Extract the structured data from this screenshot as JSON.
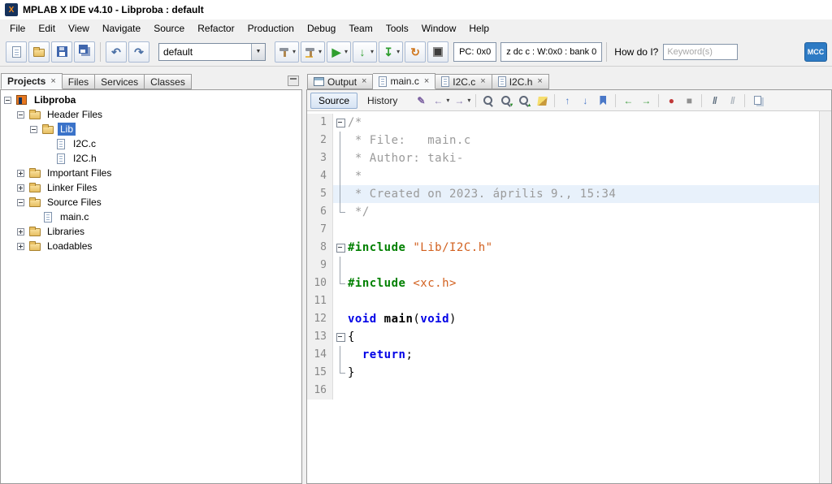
{
  "window": {
    "title": "MPLAB X IDE v4.10 - Libproba : default"
  },
  "menubar": {
    "items": [
      "File",
      "Edit",
      "View",
      "Navigate",
      "Source",
      "Refactor",
      "Production",
      "Debug",
      "Team",
      "Tools",
      "Window",
      "Help"
    ]
  },
  "toolbar": {
    "file_icons": [
      "new-file-icon",
      "open-project-icon",
      "save-icon",
      "save-all-icon"
    ],
    "history_icons": [
      "undo-icon",
      "redo-icon"
    ],
    "config_value": "default",
    "build_icons": [
      "build-project-icon",
      "clean-build-icon",
      "run-project-icon",
      "make-program-icon",
      "program-device-icon",
      "refresh-debug-icon",
      "memory-icon"
    ],
    "pc_value": "PC: 0x0",
    "status_value": "z dc c : W:0x0 : bank 0",
    "how_do_i_label": "How do I?",
    "keyword_placeholder": "Keyword(s)",
    "mcc_label": "MCC"
  },
  "left_panel": {
    "tabs": [
      {
        "label": "Projects",
        "active": true,
        "bold": true,
        "closable": true
      },
      {
        "label": "Files"
      },
      {
        "label": "Services"
      },
      {
        "label": "Classes"
      }
    ],
    "tree": [
      {
        "label": "Libproba",
        "level": 0,
        "expander": "minus",
        "icon": "project",
        "bold": true
      },
      {
        "label": "Header Files",
        "level": 1,
        "expander": "minus",
        "icon": "folder"
      },
      {
        "label": "Lib",
        "level": 2,
        "expander": "minus",
        "icon": "folder",
        "selected": true
      },
      {
        "label": "I2C.c",
        "level": 3,
        "expander": "none",
        "icon": "file"
      },
      {
        "label": "I2C.h",
        "level": 3,
        "expander": "none",
        "icon": "file"
      },
      {
        "label": "Important Files",
        "level": 1,
        "expander": "plus",
        "icon": "folder"
      },
      {
        "label": "Linker Files",
        "level": 1,
        "expander": "plus",
        "icon": "folder"
      },
      {
        "label": "Source Files",
        "level": 1,
        "expander": "minus",
        "icon": "folder"
      },
      {
        "label": "main.c",
        "level": 2,
        "expander": "none",
        "icon": "file"
      },
      {
        "label": "Libraries",
        "level": 1,
        "expander": "plus",
        "icon": "folder"
      },
      {
        "label": "Loadables",
        "level": 1,
        "expander": "plus",
        "icon": "folder"
      }
    ]
  },
  "editor": {
    "tabs": [
      {
        "label": "Output",
        "icon": "output"
      },
      {
        "label": "main.c",
        "icon": "file",
        "active": true
      },
      {
        "label": "I2C.c",
        "icon": "file"
      },
      {
        "label": "I2C.h",
        "icon": "file"
      }
    ],
    "toolbar": {
      "source_label": "Source",
      "history_label": "History",
      "icons": [
        "last-edit-icon",
        "back-icon",
        "forward-icon",
        "find-selection-icon",
        "find-next-icon",
        "find-previous-icon",
        "toggle-highlight-icon",
        "previous-bookmark-icon",
        "next-bookmark-icon",
        "toggle-bookmark-icon",
        "shift-left-icon",
        "shift-right-icon",
        "record-macro-icon",
        "stop-macro-icon",
        "comment-icon",
        "uncomment-icon",
        "diff-icon"
      ]
    },
    "code": {
      "highlight_line": 5,
      "lines": [
        {
          "n": 1,
          "fold": "start",
          "tokens": [
            {
              "t": "/*",
              "k": "comment"
            }
          ]
        },
        {
          "n": 2,
          "fold": "mid",
          "tokens": [
            {
              "t": " * File:   main.c",
              "k": "comment"
            }
          ]
        },
        {
          "n": 3,
          "fold": "mid",
          "tokens": [
            {
              "t": " * Author: taki-",
              "k": "comment"
            }
          ]
        },
        {
          "n": 4,
          "fold": "mid",
          "tokens": [
            {
              "t": " *",
              "k": "comment"
            }
          ]
        },
        {
          "n": 5,
          "fold": "mid",
          "tokens": [
            {
              "t": " * Created on 2023. április 9., 15:34",
              "k": "comment"
            }
          ]
        },
        {
          "n": 6,
          "fold": "end",
          "tokens": [
            {
              "t": " */",
              "k": "comment"
            }
          ]
        },
        {
          "n": 7,
          "fold": "none",
          "tokens": []
        },
        {
          "n": 8,
          "fold": "start",
          "tokens": [
            {
              "t": "#include ",
              "k": "directive"
            },
            {
              "t": "\"Lib/I2C.h\"",
              "k": "string"
            }
          ]
        },
        {
          "n": 9,
          "fold": "mid",
          "tokens": []
        },
        {
          "n": 10,
          "fold": "end",
          "tokens": [
            {
              "t": "#include ",
              "k": "directive"
            },
            {
              "t": "<xc.h>",
              "k": "string"
            }
          ]
        },
        {
          "n": 11,
          "fold": "none",
          "tokens": []
        },
        {
          "n": 12,
          "fold": "none",
          "tokens": [
            {
              "t": "void",
              "k": "keyword"
            },
            {
              "t": " ",
              "k": "plain"
            },
            {
              "t": "main",
              "k": "function"
            },
            {
              "t": "(",
              "k": "plain"
            },
            {
              "t": "void",
              "k": "keyword"
            },
            {
              "t": ")",
              "k": "plain"
            }
          ]
        },
        {
          "n": 13,
          "fold": "start",
          "tokens": [
            {
              "t": "{",
              "k": "plain"
            }
          ]
        },
        {
          "n": 14,
          "fold": "mid",
          "tokens": [
            {
              "t": "  ",
              "k": "plain"
            },
            {
              "t": "return",
              "k": "keyword"
            },
            {
              "t": ";",
              "k": "plain"
            }
          ]
        },
        {
          "n": 15,
          "fold": "end",
          "tokens": [
            {
              "t": "}",
              "k": "plain"
            }
          ]
        },
        {
          "n": 16,
          "fold": "none",
          "tokens": []
        }
      ]
    }
  }
}
